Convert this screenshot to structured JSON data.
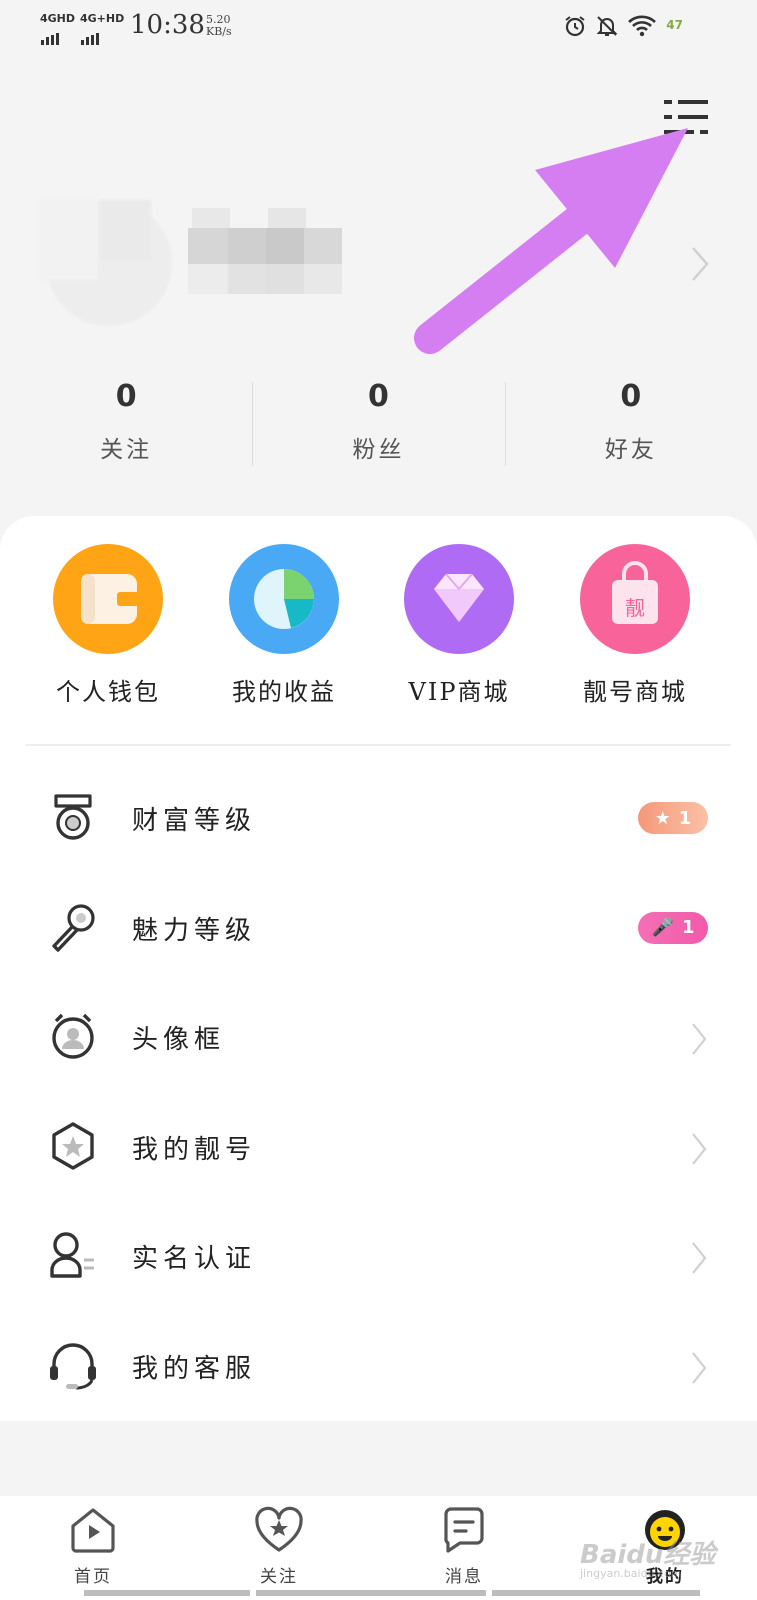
{
  "status_bar": {
    "network_1": "4GHD",
    "network_2": "4G+HD",
    "time": "10:38",
    "speed_value": "5.20",
    "speed_unit": "KB/s",
    "battery": "47"
  },
  "stats": [
    {
      "value": "0",
      "label": "关注"
    },
    {
      "value": "0",
      "label": "粉丝"
    },
    {
      "value": "0",
      "label": "好友"
    }
  ],
  "shortcuts": [
    {
      "label": "个人钱包",
      "icon": "wallet-icon",
      "color": "#ffa515"
    },
    {
      "label": "我的收益",
      "icon": "pie-chart-icon",
      "color": "#4aa9f5"
    },
    {
      "label": "VIP商城",
      "icon": "diamond-icon",
      "color": "#b06bf5"
    },
    {
      "label": "靓号商城",
      "icon": "shopping-bag-icon",
      "color": "#f8649a",
      "bag_text": "靓"
    }
  ],
  "menu": [
    {
      "label": "财富等级",
      "icon": "medal-icon",
      "badge": "1",
      "badge_icon": "star-icon"
    },
    {
      "label": "魅力等级",
      "icon": "microphone-icon",
      "badge": "1",
      "badge_icon": "microphone-icon"
    },
    {
      "label": "头像框",
      "icon": "avatar-frame-icon"
    },
    {
      "label": "我的靓号",
      "icon": "star-hexagon-icon"
    },
    {
      "label": "实名认证",
      "icon": "id-verify-icon"
    },
    {
      "label": "我的客服",
      "icon": "headset-icon"
    }
  ],
  "bottom_nav": [
    {
      "label": "首页",
      "icon": "home-icon"
    },
    {
      "label": "关注",
      "icon": "heart-star-icon"
    },
    {
      "label": "消息",
      "icon": "message-icon"
    },
    {
      "label": "我的",
      "icon": "smiley-icon",
      "active": true
    }
  ],
  "watermark": {
    "main": "Baidu经验",
    "sub": "jingyan.baidu.com"
  },
  "colors": {
    "annotation_arrow": "#d57ef2",
    "badge_wealth": "#f5a58a",
    "badge_charm": "#f05fb5"
  }
}
